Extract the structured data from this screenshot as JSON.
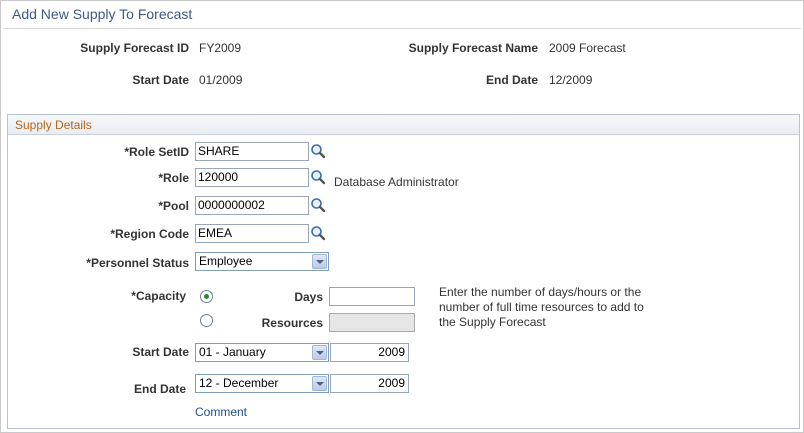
{
  "page": {
    "title": "Add New Supply To Forecast"
  },
  "summary": {
    "forecast_id_label": "Supply Forecast ID",
    "forecast_id_value": "FY2009",
    "forecast_name_label": "Supply Forecast Name",
    "forecast_name_value": "2009 Forecast",
    "start_date_label": "Start Date",
    "start_date_value": "01/2009",
    "end_date_label": "End Date",
    "end_date_value": "12/2009"
  },
  "details": {
    "section_title": "Supply Details",
    "role_setid_label": "*Role SetID",
    "role_setid_value": "SHARE",
    "role_label": "*Role",
    "role_value": "120000",
    "role_description": "Database Administrator",
    "pool_label": "*Pool",
    "pool_value": "0000000002",
    "region_label": "*Region Code",
    "region_value": "EMEA",
    "personnel_status_label": "*Personnel Status",
    "personnel_status_value": "Employee",
    "capacity_label": "*Capacity",
    "days_label": "Days",
    "days_value": "",
    "resources_label": "Resources",
    "resources_value": "",
    "capacity_help": "Enter the number of days/hours or the number of full time resources to add to the Supply Forecast",
    "start_date_label": "Start Date",
    "start_month_value": "01 - January",
    "start_year_value": "2009",
    "end_date_label": "End Date",
    "end_month_value": "12 - December",
    "end_year_value": "2009",
    "comment_link": "Comment"
  },
  "icons": {
    "lookup": "magnifier-icon",
    "dropdown": "chevron-down-icon"
  },
  "colors": {
    "title": "#3a5a89",
    "section_title": "#b5651d",
    "link": "#1f4f8f",
    "radio_selected": "#2b8a2b"
  }
}
